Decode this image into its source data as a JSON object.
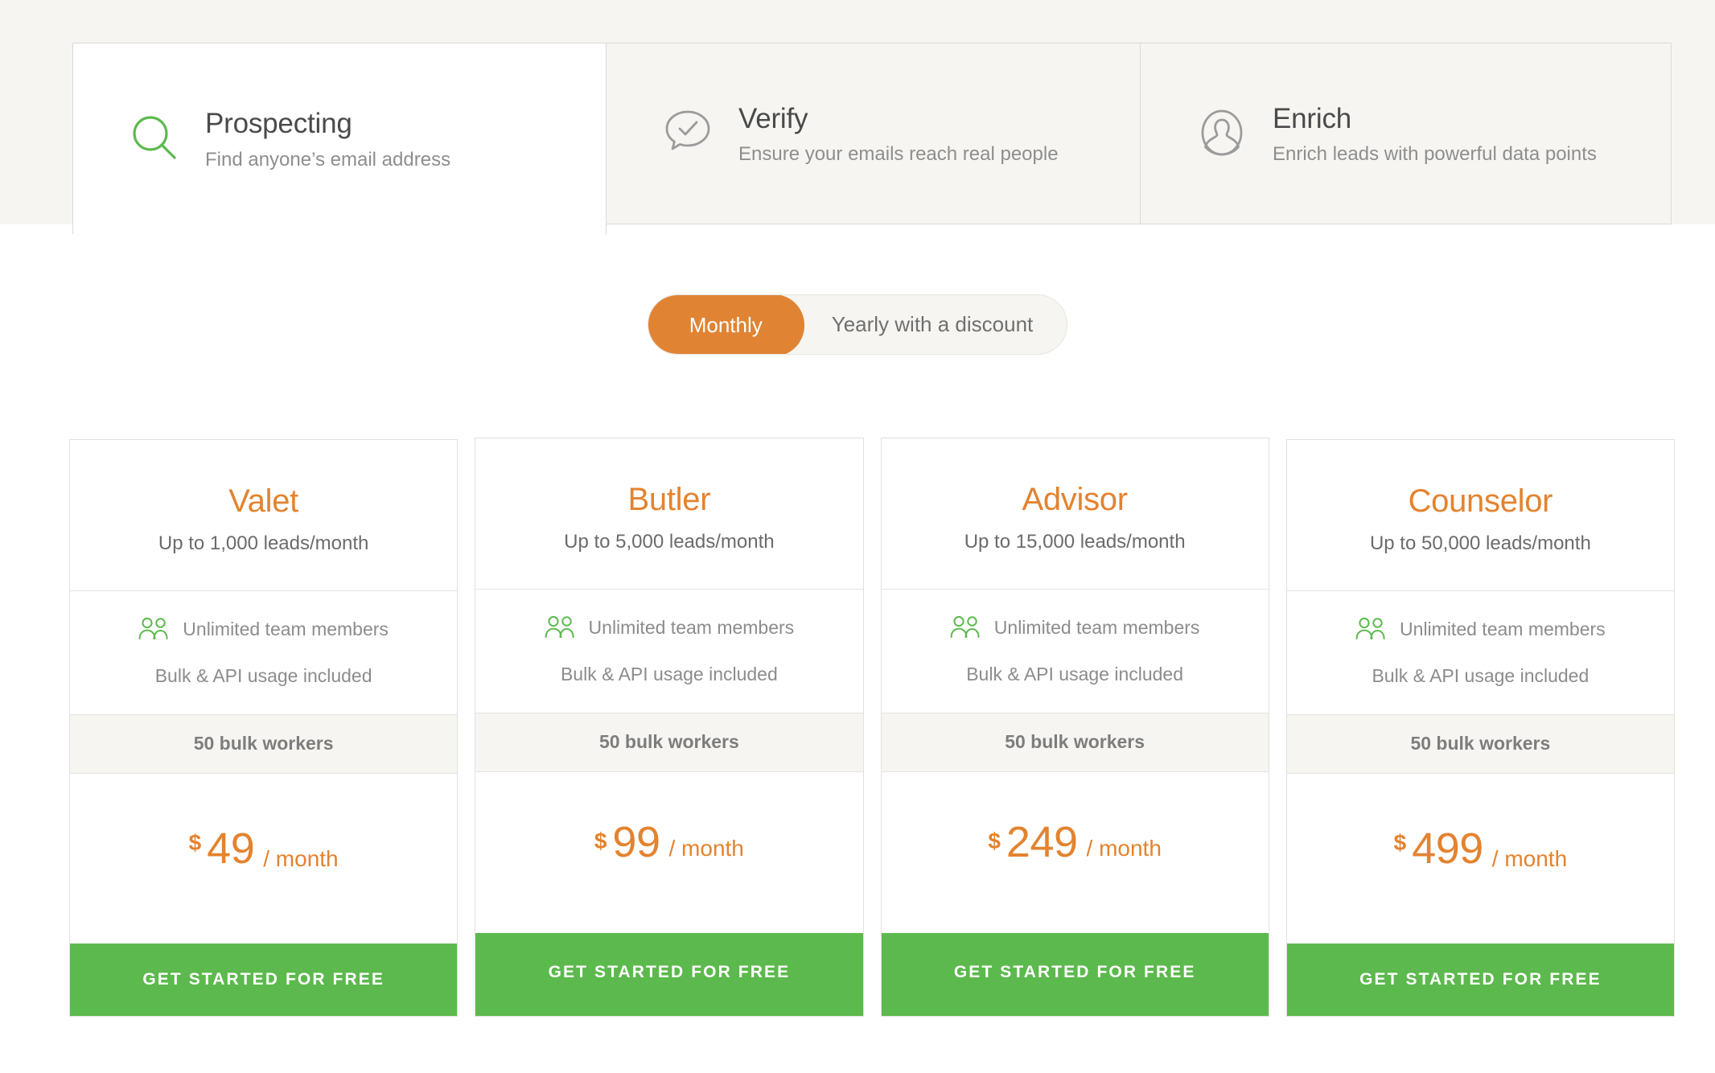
{
  "colors": {
    "accent_orange": "#e08434",
    "plan_name_orange": "#e3832f",
    "cta_green": "#5cb94d",
    "icon_green": "#5cb94d",
    "band_background": "#f6f5f1",
    "card_border": "#e4e0dc"
  },
  "header": {
    "tabs": [
      {
        "id": "prospecting",
        "icon": "search-icon",
        "title": "Prospecting",
        "subtitle": "Find anyone’s email address",
        "active": true
      },
      {
        "id": "verify",
        "icon": "speech-bubble-check-icon",
        "title": "Verify",
        "subtitle": "Ensure your emails reach real people",
        "active": false
      },
      {
        "id": "enrich",
        "icon": "person-avatar-icon",
        "title": "Enrich",
        "subtitle": "Enrich leads with powerful data points",
        "active": false
      }
    ]
  },
  "billing_toggle": {
    "selected": "Monthly",
    "options": [
      {
        "label": "Monthly",
        "active": true
      },
      {
        "label": "Yearly with a discount",
        "active": false
      }
    ]
  },
  "pricing": {
    "cta_label": "GET STARTED FOR FREE",
    "feature_team_icon": "two-people-icon",
    "plans": [
      {
        "name": "Valet",
        "leads": "Up to 1,000 leads/month",
        "feature_team": "Unlimited team members",
        "feature_bulk": "Bulk & API usage included",
        "workers": "50 bulk workers",
        "currency": "$",
        "price": "49",
        "period": "/ month",
        "cta": "GET STARTED FOR FREE"
      },
      {
        "name": "Butler",
        "leads": "Up to 5,000 leads/month",
        "feature_team": "Unlimited team members",
        "feature_bulk": "Bulk & API usage included",
        "workers": "50 bulk workers",
        "currency": "$",
        "price": "99",
        "period": "/ month",
        "cta": "GET STARTED FOR FREE"
      },
      {
        "name": "Advisor",
        "leads": "Up to 15,000 leads/month",
        "feature_team": "Unlimited team members",
        "feature_bulk": "Bulk & API usage included",
        "workers": "50 bulk workers",
        "currency": "$",
        "price": "249",
        "period": "/ month",
        "cta": "GET STARTED FOR FREE"
      },
      {
        "name": "Counselor",
        "leads": "Up to 50,000 leads/month",
        "feature_team": "Unlimited team members",
        "feature_bulk": "Bulk & API usage included",
        "workers": "50 bulk workers",
        "currency": "$",
        "price": "499",
        "period": "/ month",
        "cta": "GET STARTED FOR FREE"
      }
    ]
  }
}
